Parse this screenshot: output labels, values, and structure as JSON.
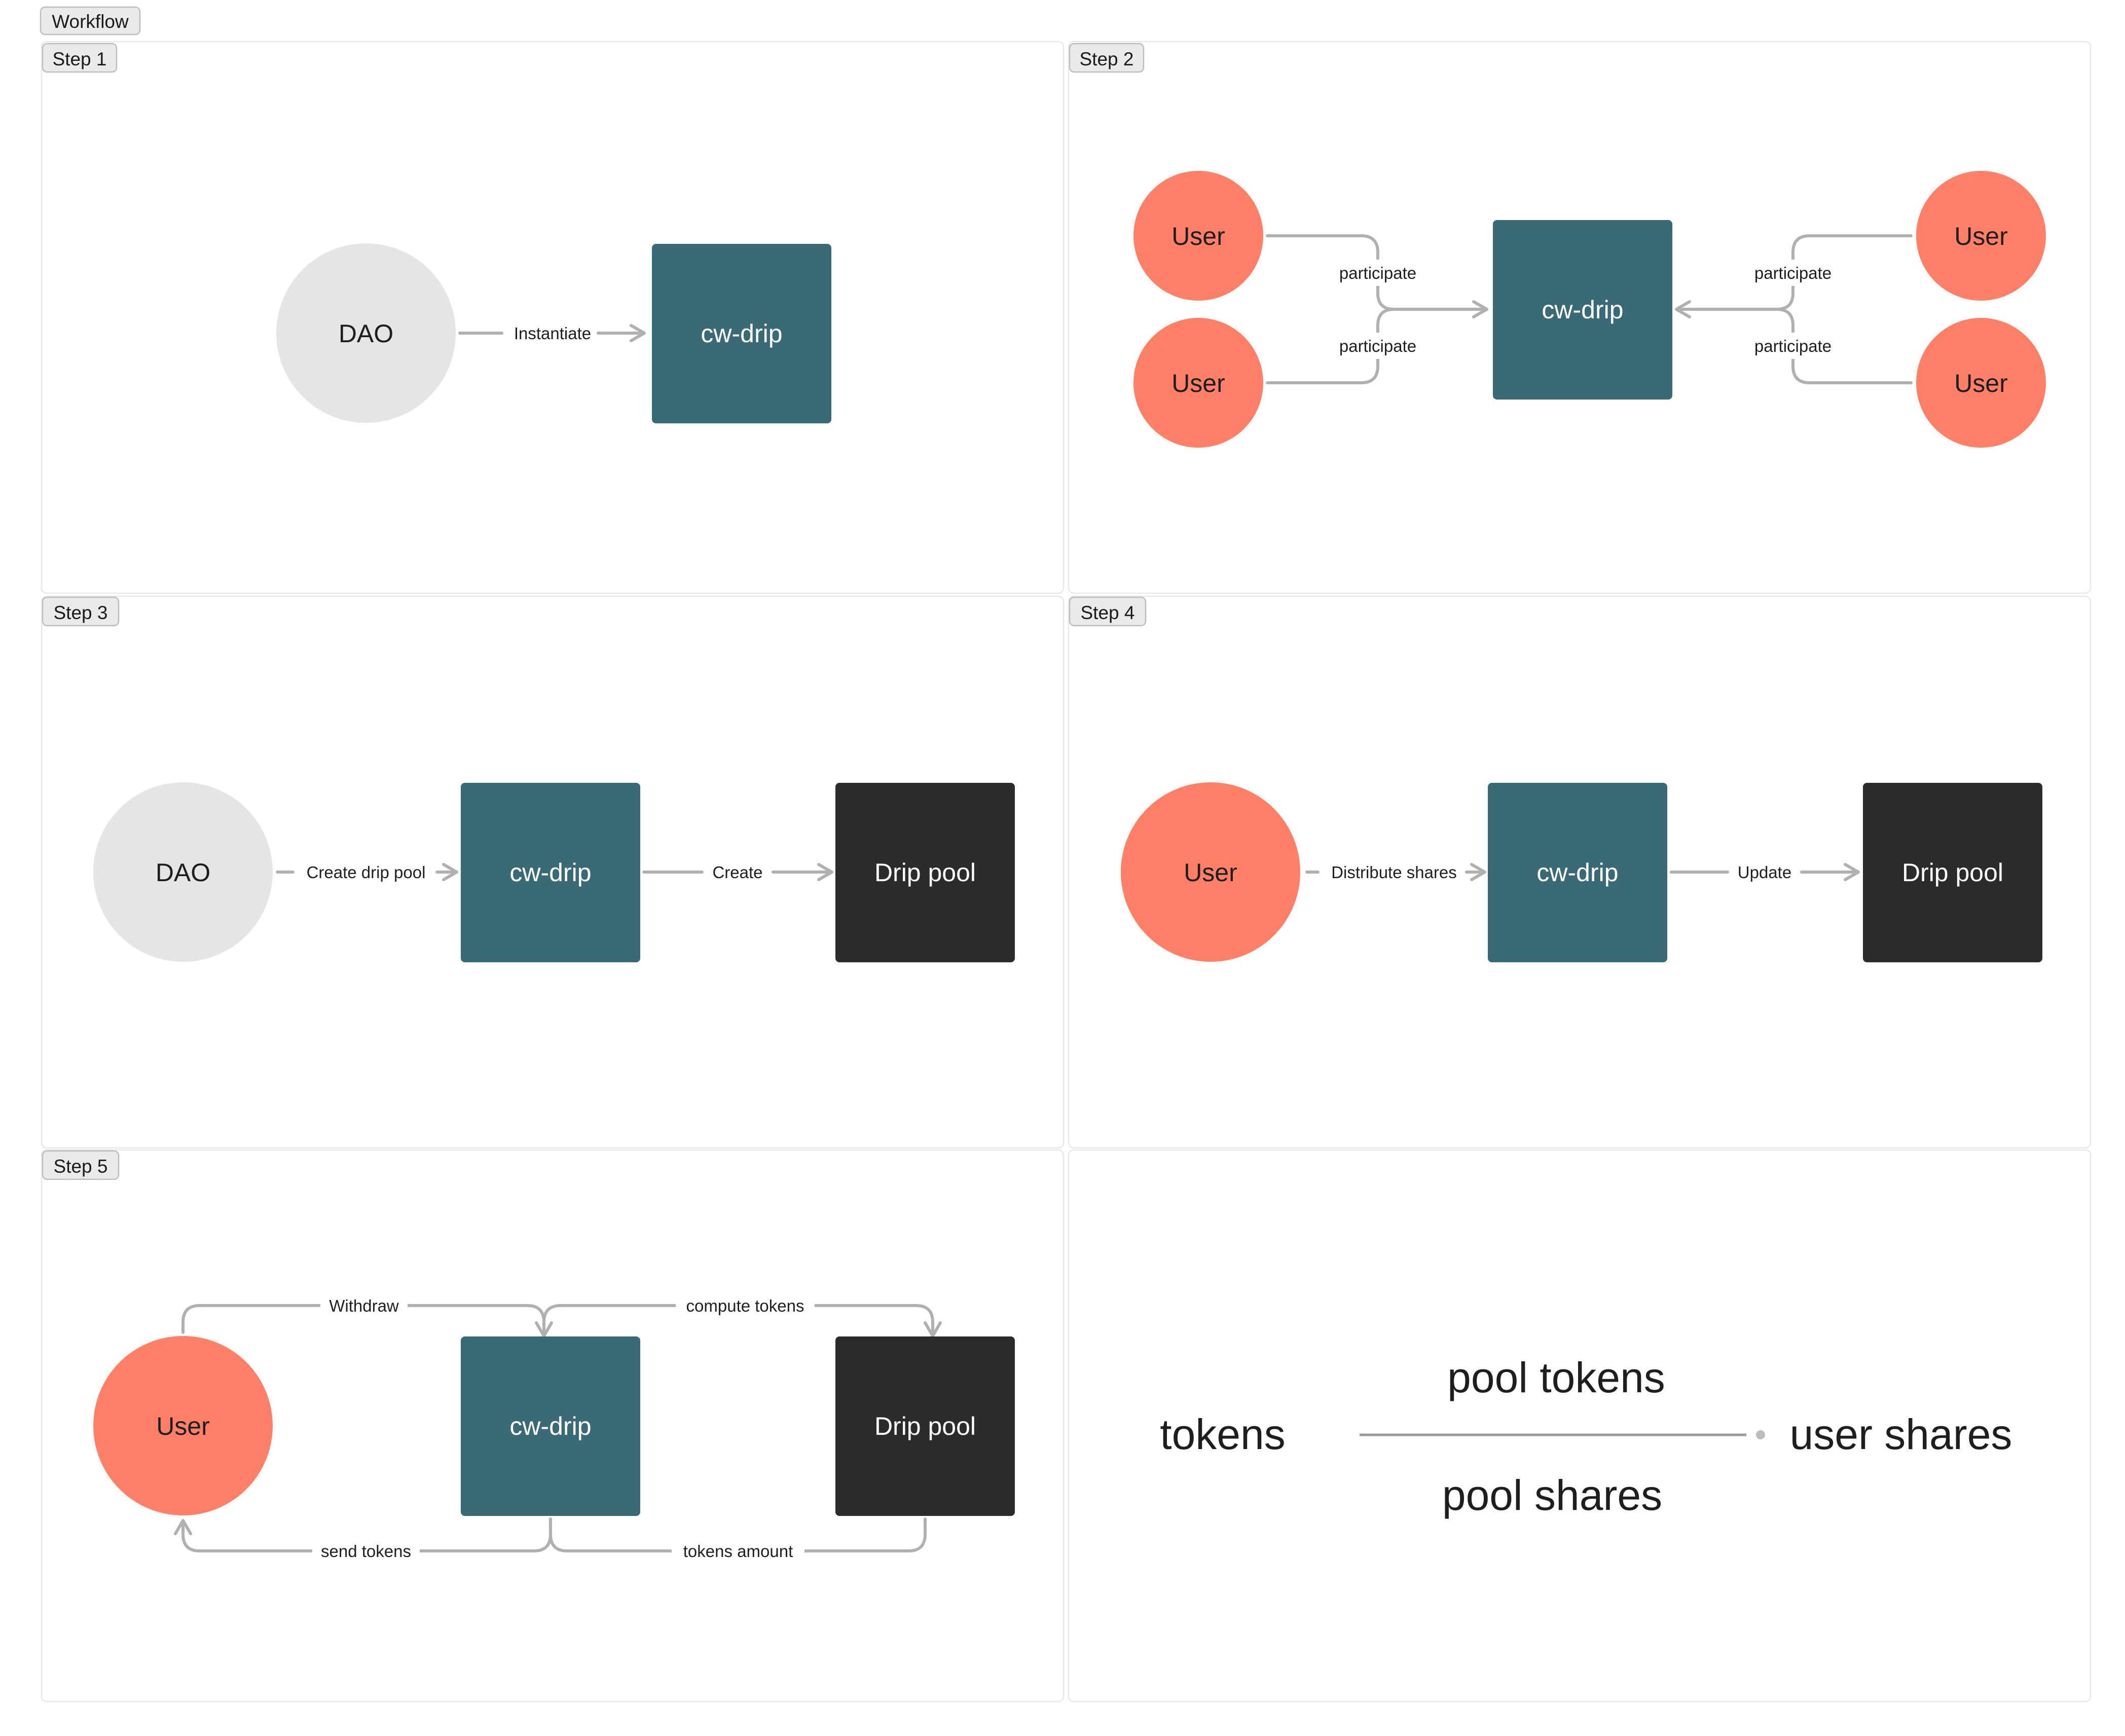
{
  "title": "Workflow",
  "colors": {
    "dao": "#e5e5e5",
    "user": "#ff8066",
    "cw_drip": "#3a6a76",
    "drip_pool": "#2b2b2b",
    "edge": "#b0b0b0",
    "frame_border": "#e8e8e8"
  },
  "steps": [
    {
      "label": "Step 1",
      "nodes": [
        {
          "id": "s1-dao",
          "text": "DAO",
          "kind": "dao"
        },
        {
          "id": "s1-drip",
          "text": "cw-drip",
          "kind": "cw_drip"
        }
      ],
      "edges": [
        {
          "id": "s1-e1",
          "from": "DAO",
          "to": "cw-drip",
          "label": "Instantiate"
        }
      ]
    },
    {
      "label": "Step 2",
      "nodes": [
        {
          "id": "s2-u1",
          "text": "User",
          "kind": "user"
        },
        {
          "id": "s2-u2",
          "text": "User",
          "kind": "user"
        },
        {
          "id": "s2-drip",
          "text": "cw-drip",
          "kind": "cw_drip"
        },
        {
          "id": "s2-u3",
          "text": "User",
          "kind": "user"
        },
        {
          "id": "s2-u4",
          "text": "User",
          "kind": "user"
        }
      ],
      "edges": [
        {
          "id": "s2-e1",
          "from": "User",
          "to": "cw-drip",
          "label": "participate"
        },
        {
          "id": "s2-e2",
          "from": "User",
          "to": "cw-drip",
          "label": "participate"
        },
        {
          "id": "s2-e3",
          "from": "User",
          "to": "cw-drip",
          "label": "participate"
        },
        {
          "id": "s2-e4",
          "from": "User",
          "to": "cw-drip",
          "label": "participate"
        }
      ]
    },
    {
      "label": "Step 3",
      "nodes": [
        {
          "id": "s3-dao",
          "text": "DAO",
          "kind": "dao"
        },
        {
          "id": "s3-drip",
          "text": "cw-drip",
          "kind": "cw_drip"
        },
        {
          "id": "s3-pool",
          "text": "Drip pool",
          "kind": "drip_pool"
        }
      ],
      "edges": [
        {
          "id": "s3-e1",
          "from": "DAO",
          "to": "cw-drip",
          "label": "Create drip pool"
        },
        {
          "id": "s3-e2",
          "from": "cw-drip",
          "to": "Drip pool",
          "label": "Create"
        }
      ]
    },
    {
      "label": "Step 4",
      "nodes": [
        {
          "id": "s4-user",
          "text": "User",
          "kind": "user"
        },
        {
          "id": "s4-drip",
          "text": "cw-drip",
          "kind": "cw_drip"
        },
        {
          "id": "s4-pool",
          "text": "Drip pool",
          "kind": "drip_pool"
        }
      ],
      "edges": [
        {
          "id": "s4-e1",
          "from": "User",
          "to": "cw-drip",
          "label": "Distribute shares"
        },
        {
          "id": "s4-e2",
          "from": "cw-drip",
          "to": "Drip pool",
          "label": "Update"
        }
      ]
    },
    {
      "label": "Step 5",
      "nodes": [
        {
          "id": "s5-user",
          "text": "User",
          "kind": "user"
        },
        {
          "id": "s5-drip",
          "text": "cw-drip",
          "kind": "cw_drip"
        },
        {
          "id": "s5-pool",
          "text": "Drip pool",
          "kind": "drip_pool"
        }
      ],
      "edges": [
        {
          "id": "s5-e1",
          "from": "User",
          "to": "cw-drip",
          "label": "Withdraw"
        },
        {
          "id": "s5-e2",
          "from": "cw-drip",
          "to": "Drip pool",
          "label": "compute tokens"
        },
        {
          "id": "s5-e3",
          "from": "Drip pool",
          "to": "cw-drip",
          "label": "tokens amount"
        },
        {
          "id": "s5-e4",
          "from": "cw-drip",
          "to": "User",
          "label": "send tokens"
        }
      ]
    }
  ],
  "formula": {
    "lhs": "tokens",
    "numerator": "pool tokens",
    "denominator": "pool shares",
    "rhs": "user shares"
  }
}
